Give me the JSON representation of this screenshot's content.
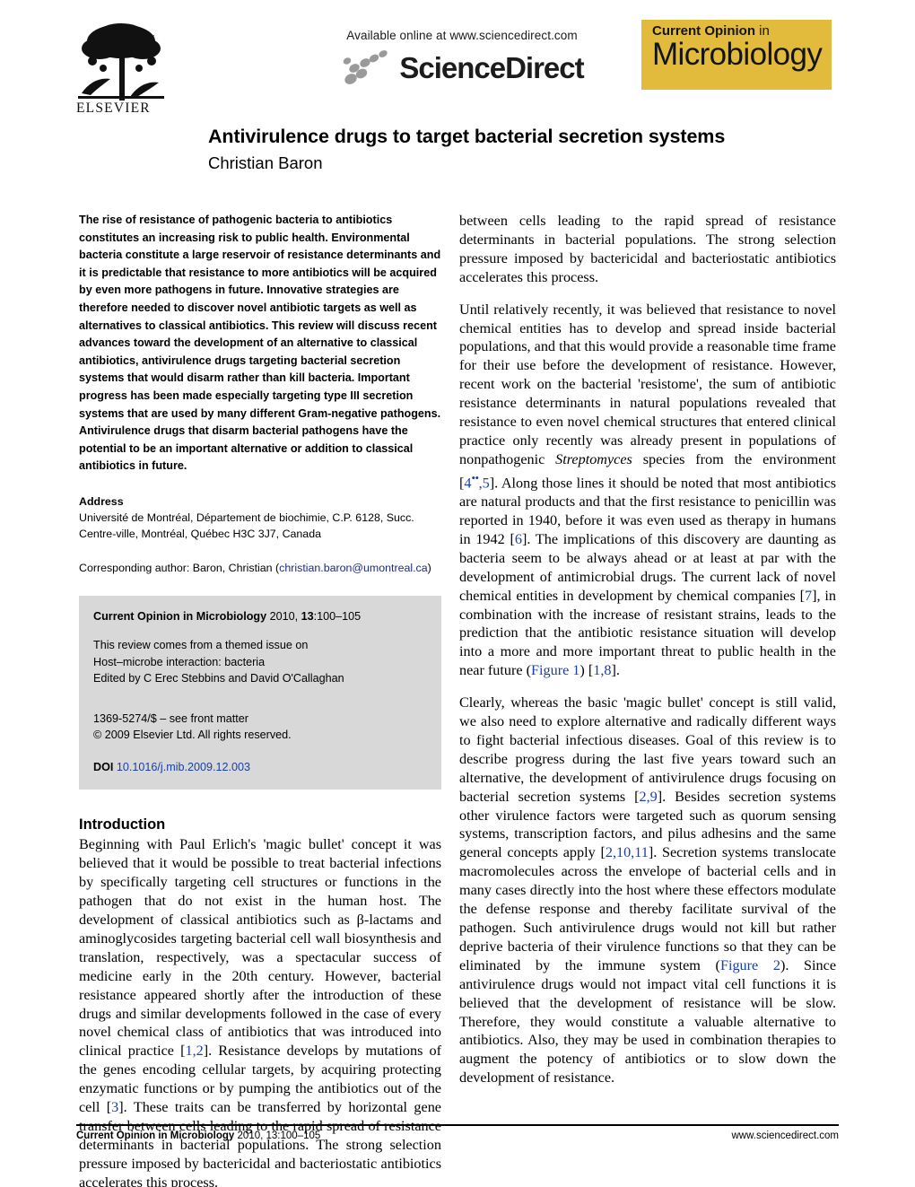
{
  "masthead": {
    "publisher_name": "ELSEVIER",
    "publisher_icon": "elsevier-tree-logo",
    "available_online": "Available online at www.sciencedirect.com",
    "sciencedirect_wordmark": "ScienceDirect",
    "sciencedirect_icon": "sciencedirect-swoosh-icon",
    "journal_badge_line1_bold": "Current Opinion",
    "journal_badge_line1_thin": " in",
    "journal_badge_line2": "Microbiology",
    "journal_badge_color": "#e3bb3c"
  },
  "article": {
    "title": "Antivirulence drugs to target bacterial secretion systems",
    "author": "Christian Baron"
  },
  "abstract": {
    "text": "The rise of resistance of pathogenic bacteria to antibiotics constitutes an increasing risk to public health. Environmental bacteria constitute a large reservoir of resistance determinants and it is predictable that resistance to more antibiotics will be acquired by even more pathogens in future. Innovative strategies are therefore needed to discover novel antibiotic targets as well as alternatives to classical antibiotics. This review will discuss recent advances toward the development of an alternative to classical antibiotics, antivirulence drugs targeting bacterial secretion systems that would disarm rather than kill bacteria. Important progress has been made especially targeting type III secretion systems that are used by many different Gram-negative pathogens. Antivirulence drugs that disarm bacterial pathogens have the potential to be an important alternative or addition to classical antibiotics in future."
  },
  "address": {
    "heading": "Address",
    "line1": "Université de Montréal, Département de biochimie, C.P. 6128, Succ.",
    "line2": "Centre-ville, Montréal, Québec H3C 3J7, Canada"
  },
  "corresponding": {
    "prefix": "Corresponding author: Baron, Christian (",
    "email": "christian.baron@umontreal.ca",
    "suffix": ")"
  },
  "citation_box": {
    "journal_bold": "Current Opinion in Microbiology",
    "journal_rest_pre": " 2010, ",
    "volume": "13",
    "pages": ":100–105",
    "themed_line1": "This review comes from a themed issue on",
    "themed_line2": "Host–microbe interaction: bacteria",
    "themed_line3": "Edited by C Erec Stebbins and David O'Callaghan",
    "issn_line": "1369-5274/$ – see front matter",
    "copyright_line": "© 2009 Elsevier Ltd. All rights reserved.",
    "doi_label": "DOI",
    "doi_value": "10.1016/j.mib.2009.12.003"
  },
  "introduction": {
    "heading": "Introduction",
    "paragraph1_a": "Beginning with Paul Erlich's 'magic bullet' concept it was believed that it would be possible to treat bacterial infections by specifically targeting cell structures or functions in the pathogen that do not exist in the human host. The development of classical antibiotics such as β-lactams and aminoglycosides targeting bacterial cell wall biosynthesis and translation, respectively, was a spectacular success of medicine early in the 20th century. However, bacterial resistance appeared shortly after the introduction of these drugs and similar developments followed in the case of every novel chemical class of antibiotics that was introduced into clinical practice [",
    "ref_1_2": "1,2",
    "paragraph1_b": "]. Resistance develops by mutations of the genes encoding cellular targets, by acquiring protecting enzymatic functions or by pumping the antibiotics out of the cell [",
    "ref_3": "3",
    "paragraph1_c": "]. These traits can be transferred by horizontal gene transfer between cells leading to the rapid spread of resistance determinants in bacterial populations. The strong selection pressure imposed by bactericidal and bacteriostatic antibiotics accelerates this process."
  },
  "right_column": {
    "para_cont_1": "between cells leading to the rapid spread of resistance determinants in bacterial populations. The strong selection pressure imposed by bactericidal and bacteriostatic antibiotics accelerates this process.",
    "para2_a": "Until relatively recently, it was believed that resistance to novel chemical entities has to develop and spread inside bacterial populations, and that this would provide a reasonable time frame for their use before the development of resistance. However, recent work on the bacterial 'resistome', the sum of antibiotic resistance determinants in natural populations revealed that resistance to even novel chemical structures that entered clinical practice only recently was already present in populations of nonpathogenic ",
    "para2_italic": "Streptomyces",
    "para2_b": " species from the environment [",
    "para2_ref4": "4",
    "para2_ref4_dots": "••",
    "para2_ref5": ",5",
    "para2_c": "]. Along those lines it should be noted that most antibiotics are natural products and that the first resistance to penicillin was reported in 1940, before it was even used as therapy in humans in 1942 [",
    "para2_ref6": "6",
    "para2_d": "]. The implications of this discovery are daunting as bacteria seem to be always ahead or at least at par with the development of antimicrobial drugs. The current lack of novel chemical entities in development by chemical companies [",
    "para2_ref7": "7",
    "para2_e": "], in combination with the increase of resistant strains, leads to the prediction that the antibiotic resistance situation will develop into a more and more important threat to public health in the near future (",
    "para2_figure1": "Figure 1",
    "para2_f": ") [",
    "para2_ref18": "1,8",
    "para2_g": "].",
    "para3_a": "Clearly, whereas the basic 'magic bullet' concept is still valid, we also need to explore alternative and radically different ways to fight bacterial infectious diseases. Goal of this review is to describe progress during the last five years toward such an alternative, the development of antivirulence drugs focusing on bacterial secretion systems [",
    "para3_ref29": "2,9",
    "para3_b": "]. Besides secretion systems other virulence factors were targeted such as quorum sensing systems, transcription factors, and pilus adhesins and the same general concepts apply [",
    "para3_ref21011": "2,10,11",
    "para3_c": "]. Secretion systems translocate macromolecules across the envelope of bacterial cells and in many cases directly into the host where these effectors modulate the defense response and thereby facilitate survival of the pathogen. Such antivirulence drugs would not kill but rather deprive bacteria of their virulence functions so that they can be eliminated by the immune system (",
    "para3_figure2": "Figure 2",
    "para3_d": "). Since antivirulence drugs would not impact vital cell functions it is believed that the development of resistance will be slow. Therefore, they would constitute a valuable alternative to antibiotics. Also, they may be used in combination therapies to augment the potency of antibiotics or to slow down the development of resistance."
  },
  "footer": {
    "left_bold": "Current Opinion in Microbiology",
    "left_rest": " 2010, 13:100–105",
    "right": "www.sciencedirect.com"
  }
}
